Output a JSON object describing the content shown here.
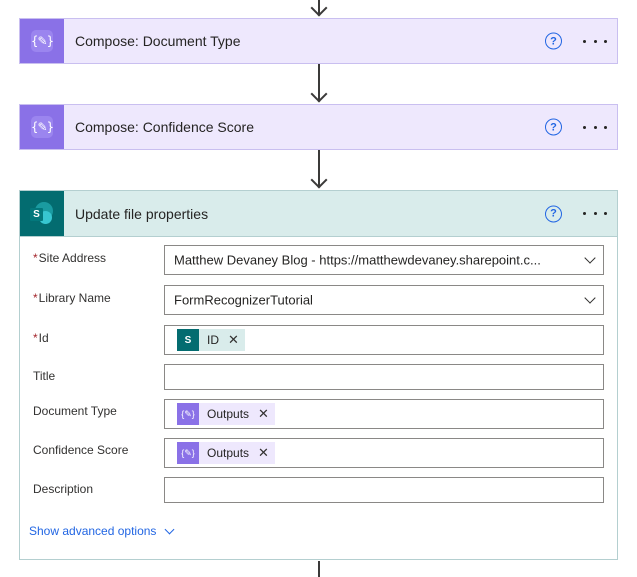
{
  "steps": [
    {
      "title": "Compose: Document Type",
      "icon": "compose-braces-icon"
    },
    {
      "title": "Compose: Confidence Score",
      "icon": "compose-braces-icon"
    }
  ],
  "sharepoint_action": {
    "title": "Update file properties",
    "icon": "sharepoint-icon",
    "logo_letter": "S",
    "fields": {
      "site_address": {
        "label": "Site Address",
        "required": "*",
        "value": "Matthew Devaney Blog - https://matthewdevaney.sharepoint.c..."
      },
      "library_name": {
        "label": "Library Name",
        "required": "*",
        "value": "FormRecognizerTutorial"
      },
      "id": {
        "label": "Id",
        "required": "*",
        "token": "ID"
      },
      "title": {
        "label": "Title"
      },
      "document_type": {
        "label": "Document Type",
        "token": "Outputs"
      },
      "confidence_score": {
        "label": "Confidence Score",
        "token": "Outputs"
      },
      "description": {
        "label": "Description"
      }
    },
    "advanced_link": "Show advanced options"
  },
  "icons": {
    "help": "?",
    "close": "✕",
    "compose_glyph": "{✎}"
  },
  "colors": {
    "compose_accent": "#8a71e7",
    "compose_bg": "#eee8fd",
    "sharepoint_accent": "#036c70",
    "sharepoint_bg": "#d9eceb",
    "link": "#2266e3"
  }
}
